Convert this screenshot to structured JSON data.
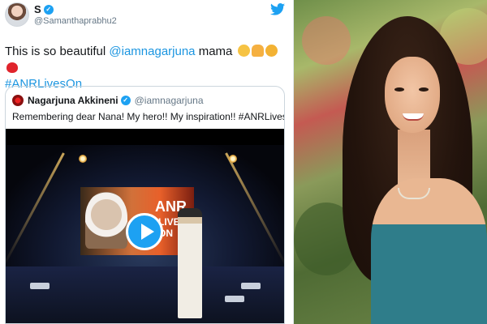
{
  "tweet": {
    "display_name": "S",
    "handle": "@Samanthaprabhu2",
    "text_prefix": "This is so beautiful ",
    "mention": "@iamnagarjuna",
    "text_suffix": " mama",
    "emojis": [
      "slightly-smiling-face",
      "folded-hands",
      "hugging-face",
      "red-heart"
    ],
    "hashtag": "#ANRLivesOn",
    "brand_icon": "twitter-bird-icon",
    "accent_color": "#1da1f2"
  },
  "quoted_tweet": {
    "display_name": "Nagarjuna Akkineni",
    "handle": "@iamnagarjuna",
    "text": "Remembering dear Nana! My hero!! My inspiration!! #ANRLivesOn",
    "video": {
      "screen_text_main": "ANR",
      "screen_text_sub": "LIVES ON",
      "play_icon": "play-icon"
    }
  },
  "photo": {
    "subject": "portrait-photo"
  }
}
